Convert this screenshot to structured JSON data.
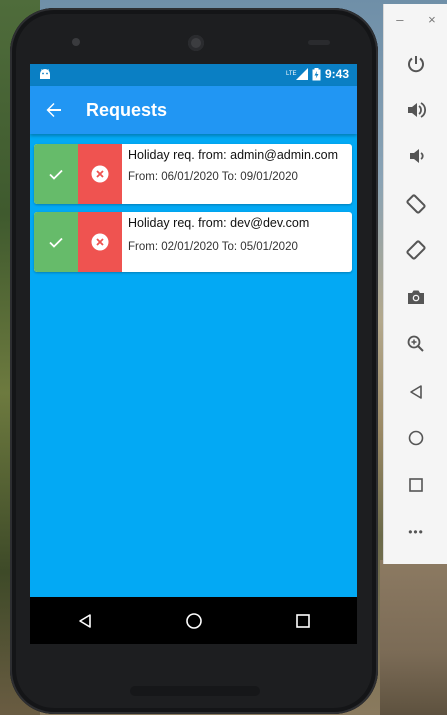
{
  "status_bar": {
    "network": "LTE",
    "time": "9:43"
  },
  "app_bar": {
    "title": "Requests"
  },
  "requests": [
    {
      "title": "Holiday req. from: admin@admin.com",
      "dates": "From: 06/01/2020 To: 09/01/2020"
    },
    {
      "title": "Holiday req. from: dev@dev.com",
      "dates": "From: 02/01/2020 To: 05/01/2020"
    }
  ],
  "emulator_toolbar": {
    "minimize": "–",
    "close": "×",
    "more": "•••"
  },
  "colors": {
    "app_bar": "#2196f3",
    "status_bar": "#0a7fc4",
    "screen_background": "#03a9f4",
    "accept": "#66bb6a",
    "reject": "#ef5350"
  }
}
